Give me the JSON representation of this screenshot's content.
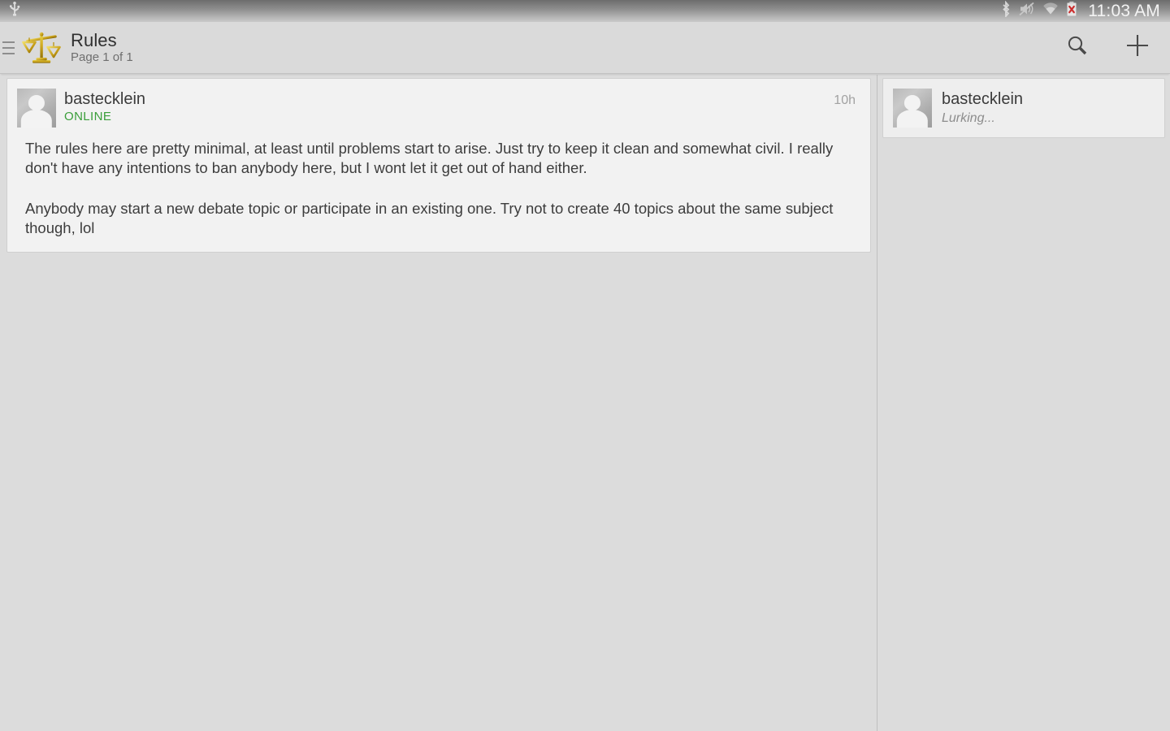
{
  "status_bar": {
    "left_icons": [
      {
        "name": "usb-icon",
        "glyph": "usb"
      }
    ],
    "right_icons": [
      {
        "name": "bluetooth-icon",
        "glyph": "bluetooth"
      },
      {
        "name": "volume-mute-icon",
        "glyph": "speaker-muted"
      },
      {
        "name": "wifi-icon",
        "glyph": "wifi"
      },
      {
        "name": "battery-error-icon",
        "glyph": "battery-x"
      }
    ],
    "clock": "11:03 AM"
  },
  "action_bar": {
    "drawer_label": "menu",
    "app_icon": "scales-of-justice-icon",
    "title": "Rules",
    "subtitle": "Page 1 of 1",
    "actions": [
      {
        "name": "search-button",
        "icon": "search-icon"
      },
      {
        "name": "add-button",
        "icon": "plus-icon"
      }
    ]
  },
  "main": {
    "post": {
      "author": "bastecklein",
      "status": "ONLINE",
      "status_color": "#3a9e3a",
      "timestamp": "10h",
      "avatar": "default-user-avatar",
      "paragraphs": [
        "The rules here are pretty minimal, at least until problems start to arise. Just try to keep it clean and somewhat civil. I really don't have any intentions to ban anybody here, but I wont let it get out of hand either.",
        "Anybody may start a new debate topic or participate in an existing one. Try not to create 40 topics about the same subject though, lol"
      ]
    }
  },
  "sidebar": {
    "online_users": [
      {
        "name": "bastecklein",
        "activity": "Lurking...",
        "avatar": "default-user-avatar"
      }
    ]
  },
  "colors": {
    "page_background": "#dcdcdc",
    "action_bar": "#dadada",
    "card_background": "#f2f2f2",
    "card_border": "#cfcfcf",
    "online_green": "#3a9e3a",
    "icon_gold": "#c9a227"
  }
}
